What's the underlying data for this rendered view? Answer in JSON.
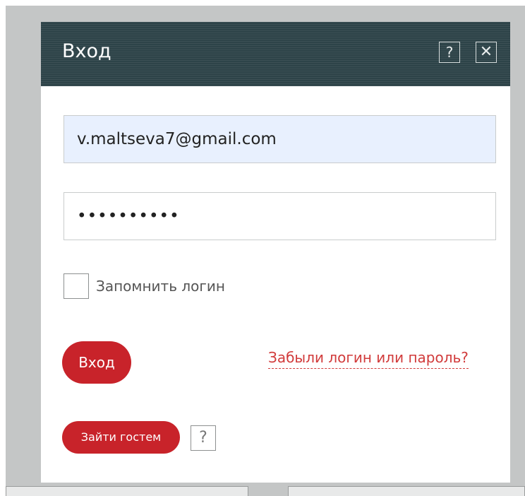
{
  "dialog": {
    "title": "Вход",
    "help_icon_glyph": "?",
    "close_icon_glyph": "✕",
    "header_color": "#2d4348"
  },
  "form": {
    "email_value": "v.maltseva7@gmail.com",
    "password_value": "••••••••••",
    "remember_label": "Запомнить логин",
    "remember_checked": false
  },
  "actions": {
    "login_label": "Вход",
    "forgot_label": "Забыли логин или пароль?",
    "guest_label": "Зайти гостем",
    "guest_help_glyph": "?",
    "accent_color": "#c8232a"
  }
}
